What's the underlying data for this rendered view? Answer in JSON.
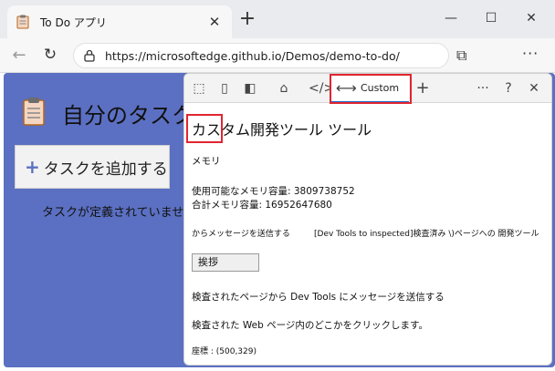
{
  "browser": {
    "tab_title": "To Do アプリ",
    "url": "https://microsoftedge.github.io/Demos/demo-to-do/"
  },
  "app": {
    "title": "自分のタスク",
    "add_button": "タスクを追加する",
    "empty_message": "タスクが定義されていません"
  },
  "devtools": {
    "custom_tab_label": "Custom",
    "panel_title": "カスタム開発ツール ツール",
    "memory_heading": "メモリ",
    "available_memory": "使用可能なメモリ容量: 3809738752",
    "total_memory": "合計メモリ容量: 16952647680",
    "send_from": "からメッセージを送信する",
    "send_to": "[Dev Tools to inspected]検査済み \\)ページへの 開発ツール",
    "greet_button": "挨拶",
    "send_page_to_devtools": "検査されたページから Dev Tools にメッセージを送信する",
    "click_instruction": "検査された Web ページ内のどこかをクリックします。",
    "coordinates": "座標 : (500,329)"
  },
  "colors": {
    "app_background": "#5b70c2",
    "active_tab_underline": "#1b6ac9",
    "highlight_red": "#e0252f"
  }
}
